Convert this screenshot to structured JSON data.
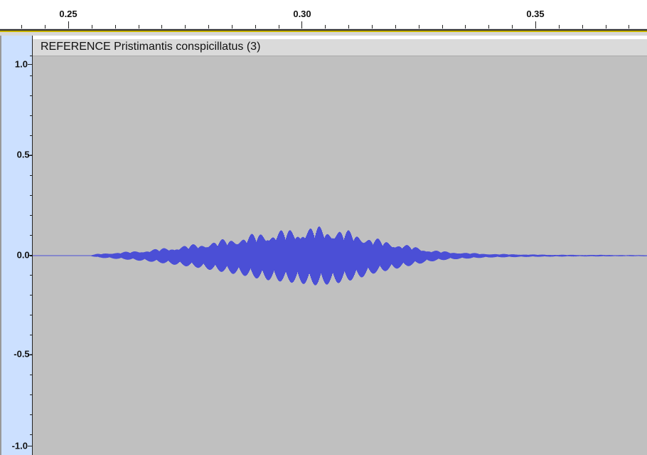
{
  "track": {
    "title": "REFERENCE Pristimantis conspicillatus (3)"
  },
  "time_ruler": {
    "labels": [
      "0.25",
      "0.30",
      "0.35"
    ],
    "unit": "seconds"
  },
  "amplitude_scale": {
    "labels": [
      "1.0",
      "0.5-",
      "0.0-",
      "-0.5-",
      "-1.0"
    ]
  },
  "chart_data": {
    "type": "line",
    "title": "REFERENCE Pristimantis conspicillatus (3)",
    "xlabel": "",
    "ylabel": "",
    "xlim": [
      0.2431,
      0.3745
    ],
    "ylim": [
      -1.0,
      1.0
    ],
    "ticks_x": [
      0.25,
      0.3,
      0.35
    ],
    "ticks_y": [
      1.0,
      0.5,
      0.0,
      -0.5,
      -1.0
    ],
    "series": [
      {
        "color": "#4b4fd6",
        "envelope": {
          "x": [
            0.243,
            0.255,
            0.257,
            0.263,
            0.268,
            0.273,
            0.278,
            0.283,
            0.288,
            0.292,
            0.296,
            0.3,
            0.304,
            0.308,
            0.312,
            0.316,
            0.32,
            0.324,
            0.328,
            0.332,
            0.336,
            0.34,
            0.345,
            0.35,
            0.355,
            0.36,
            0.365,
            0.37,
            0.3745
          ],
          "max": [
            0.0,
            0.0,
            0.01,
            0.02,
            0.03,
            0.045,
            0.06,
            0.08,
            0.1,
            0.12,
            0.13,
            0.14,
            0.15,
            0.14,
            0.12,
            0.09,
            0.07,
            0.05,
            0.03,
            0.02,
            0.015,
            0.01,
            0.008,
            0.006,
            0.005,
            0.004,
            0.004,
            0.003,
            0.003
          ],
          "min": [
            0.0,
            0.0,
            -0.01,
            -0.02,
            -0.03,
            -0.045,
            -0.06,
            -0.08,
            -0.1,
            -0.12,
            -0.13,
            -0.14,
            -0.15,
            -0.14,
            -0.12,
            -0.09,
            -0.07,
            -0.05,
            -0.03,
            -0.02,
            -0.015,
            -0.01,
            -0.008,
            -0.006,
            -0.005,
            -0.004,
            -0.004,
            -0.003,
            -0.003
          ]
        }
      }
    ]
  },
  "colors": {
    "waveform": "#4b4fd6",
    "canvas": "#c0c0c0",
    "scale_bg": "#cce0ff",
    "title_bar": "#dadada",
    "ruler_accent": "#c8b400"
  }
}
